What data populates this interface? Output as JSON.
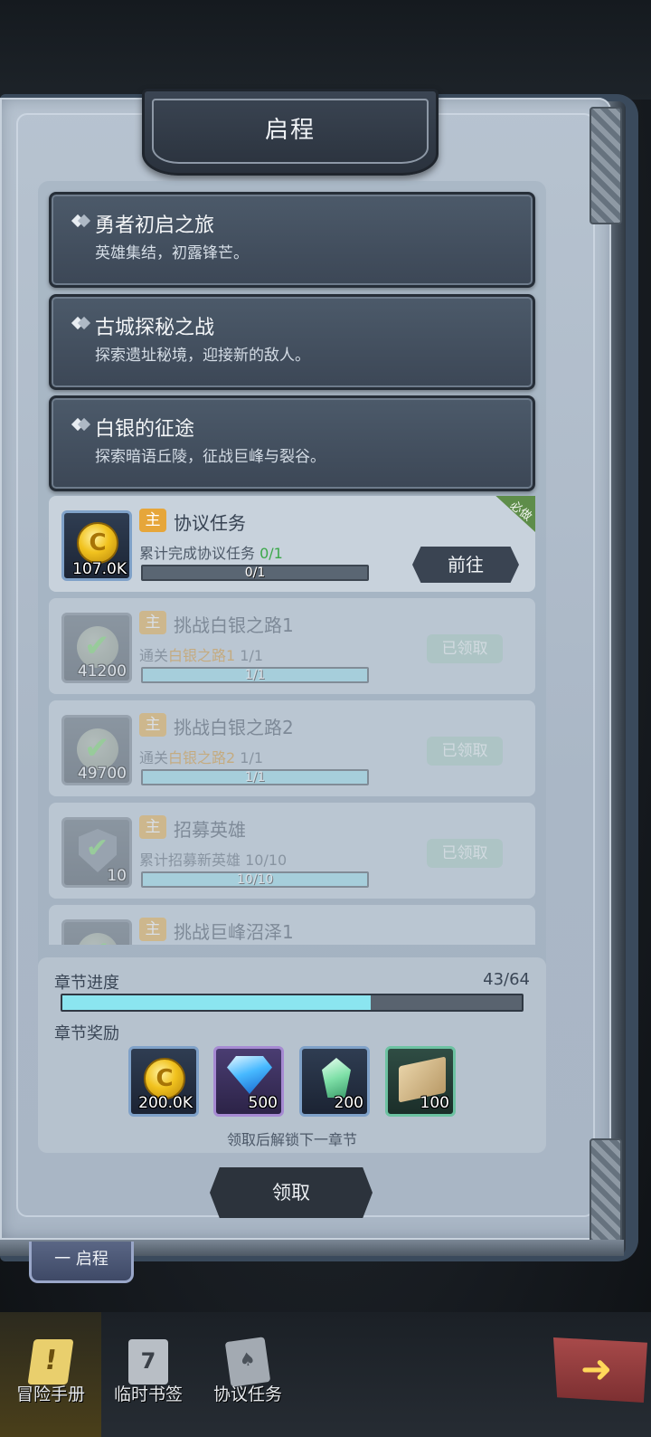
{
  "header": {
    "title": "启程"
  },
  "chapters": [
    {
      "title": "勇者初启之旅",
      "desc": "英雄集结，初露锋芒。"
    },
    {
      "title": "古城探秘之战",
      "desc": "探索遗址秘境，迎接新的敌人。"
    },
    {
      "title": "白银的征途",
      "desc": "探索暗语丘陵，征战巨峰与裂谷。"
    }
  ],
  "tasks": [
    {
      "tag": "主",
      "title": "协议任务",
      "desc_prefix": "累计完成协议任务 ",
      "desc_progress": "0/1",
      "progress_text": "0/1",
      "progress": 0.0,
      "reward_amount": "107.0K",
      "button": "前往",
      "required": "必做"
    },
    {
      "tag": "主",
      "title": "挑战白银之路1",
      "desc_prefix": "通关",
      "desc_highlight": "白银之路1",
      "desc_progress": " 1/1",
      "progress_text": "1/1",
      "progress": 1.0,
      "reward_amount": "41200",
      "button": "已领取"
    },
    {
      "tag": "主",
      "title": "挑战白银之路2",
      "desc_prefix": "通关",
      "desc_highlight": "白银之路2",
      "desc_progress": " 1/1",
      "progress_text": "1/1",
      "progress": 1.0,
      "reward_amount": "49700",
      "button": "已领取"
    },
    {
      "tag": "主",
      "title": "招募英雄",
      "desc_prefix": "累计招募新英雄 ",
      "desc_progress": "10/10",
      "progress_text": "10/10",
      "progress": 1.0,
      "reward_amount": "10",
      "button": "已领取"
    },
    {
      "tag": "主",
      "title": "挑战巨峰沼泽1"
    }
  ],
  "chapter_progress": {
    "label": "章节进度",
    "count": "43/64",
    "fraction": 0.672,
    "reward_label": "章节奖励",
    "rewards": [
      {
        "icon": "gold-coin-icon",
        "amount": "200.0K"
      },
      {
        "icon": "diamond-icon",
        "amount": "500"
      },
      {
        "icon": "crystal-shard-icon",
        "amount": "200"
      },
      {
        "icon": "scroll-icon",
        "amount": "100"
      }
    ],
    "note": "领取后解锁下一章节"
  },
  "claim_button": "领取",
  "chapter_tab": "一 启程",
  "nav": [
    {
      "label": "冒险手册",
      "icon": "adventure-book-icon",
      "active": true
    },
    {
      "label": "临时书签",
      "icon": "calendar-icon",
      "active": false
    },
    {
      "label": "协议任务",
      "icon": "papers-icon",
      "active": false
    }
  ],
  "colors": {
    "accent": "#8be5f0",
    "tag": "#e6a63a",
    "highlight": "#d28b1f",
    "required_ribbon": "#5e8d4a"
  }
}
